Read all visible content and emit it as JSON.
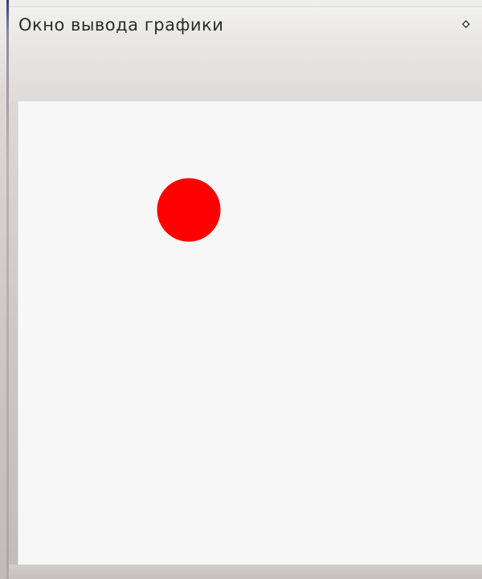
{
  "window": {
    "title": "Окно вывода графики"
  },
  "icons": {
    "window_control": "window-menu-icon"
  },
  "canvas": {
    "background_color": "#f7f7f7",
    "shapes": [
      {
        "type": "circle",
        "fill": "#ff0000",
        "name": "red-circle"
      }
    ]
  }
}
